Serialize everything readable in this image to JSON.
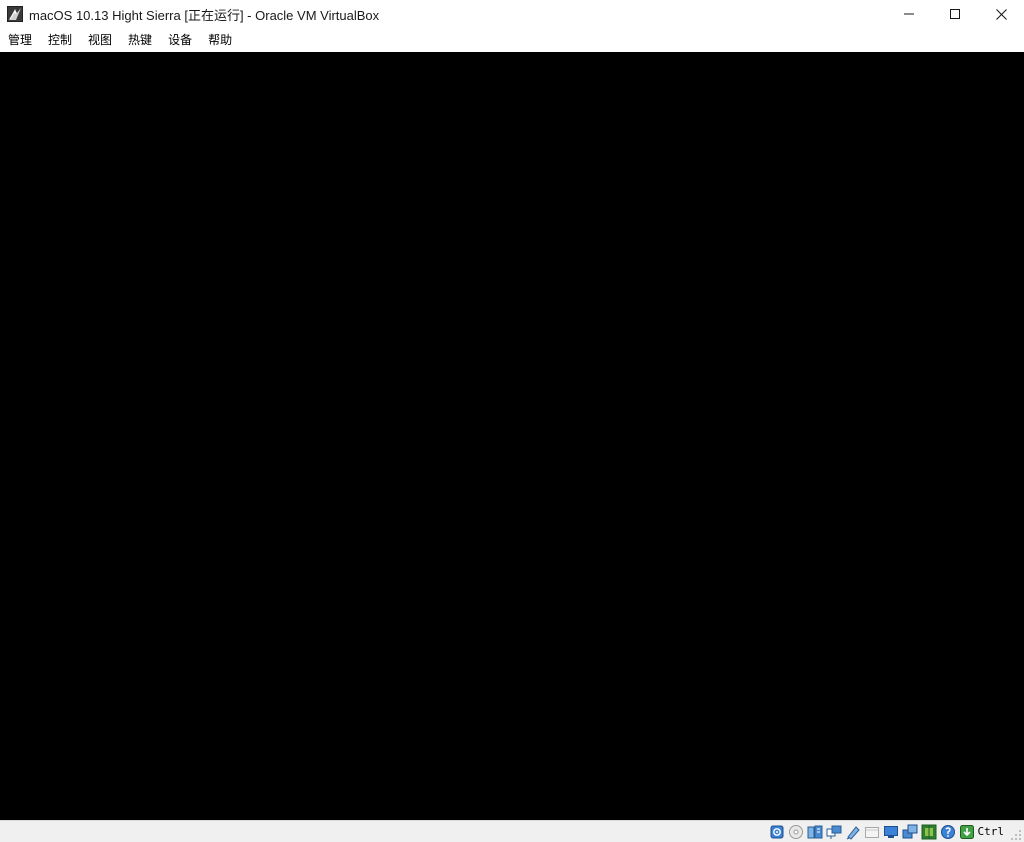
{
  "window": {
    "title": "macOS 10.13 Hight Sierra [正在运行] - Oracle VM VirtualBox",
    "app_icon": "virtualbox-app-icon",
    "caption": {
      "minimize_icon": "minimize-icon",
      "maximize_icon": "maximize-icon",
      "close_icon": "close-icon"
    }
  },
  "menu": {
    "items": [
      {
        "label": "管理"
      },
      {
        "label": "控制"
      },
      {
        "label": "视图"
      },
      {
        "label": "热键"
      },
      {
        "label": "设备"
      },
      {
        "label": "帮助"
      }
    ]
  },
  "statusbar": {
    "icons": [
      "hard-disk-icon",
      "optical-drive-icon",
      "audio-icon",
      "network-icon",
      "usb-icon",
      "shared-folder-icon",
      "display-icon",
      "video-capture-icon",
      "cpu-activity-icon",
      "mouse-integration-icon",
      "keyboard-capture-icon"
    ],
    "host_key": "Ctrl"
  },
  "colors": {
    "vm_background": "#000000",
    "titlebar_background": "#ffffff",
    "statusbar_background": "#f0f0f0"
  }
}
